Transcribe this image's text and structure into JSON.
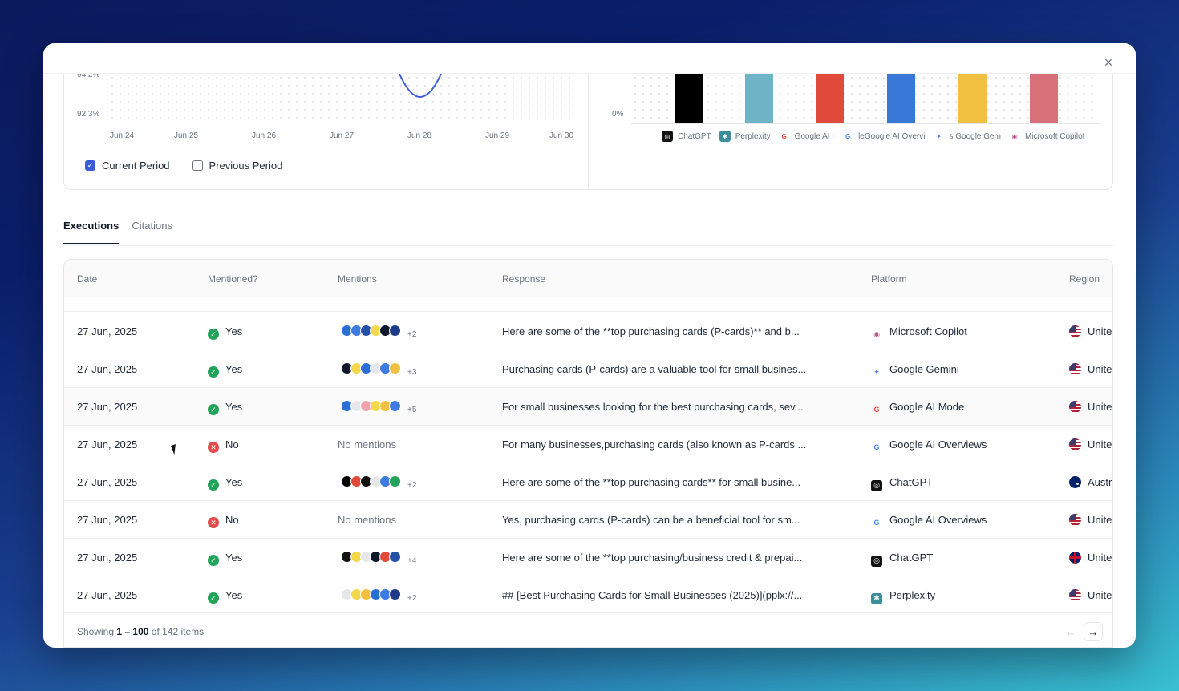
{
  "dialog": {
    "close_icon": "×"
  },
  "line_chart": {
    "y_ticks": [
      "94.2%",
      "92.3%"
    ],
    "x_ticks": [
      "Jun 24",
      "Jun 25",
      "Jun 26",
      "Jun 27",
      "Jun 28",
      "Jun 29",
      "Jun 30"
    ],
    "legend": {
      "current": "Current Period",
      "previous": "Previous Period",
      "current_checked": true,
      "previous_checked": false
    }
  },
  "bar_chart": {
    "y_tick": "0%",
    "bars": [
      {
        "platform": "ChatGPT",
        "color": "#000000"
      },
      {
        "platform": "Perplexity",
        "color": "#6fb3c6"
      },
      {
        "platform": "Google AI Mode",
        "color": "#e04a3a"
      },
      {
        "platform": "Google AI Overviews",
        "color": "#3a78d8"
      },
      {
        "platform": "Google Gemini",
        "color": "#f2c040"
      },
      {
        "platform": "Microsoft Copilot",
        "color": "#d8707a"
      }
    ],
    "legend": [
      {
        "label": "ChatGPT",
        "icon": "chatgpt-icon"
      },
      {
        "label": "Perplexity",
        "icon": "perplexity-icon"
      },
      {
        "label": "Google AI I",
        "icon": "google-icon"
      },
      {
        "label": "leGoogle AI Overvi",
        "icon": "google-icon"
      },
      {
        "label": "s Google Gem",
        "icon": "gemini-icon"
      },
      {
        "label": "Microsoft Copilot",
        "icon": "copilot-icon"
      }
    ]
  },
  "tabs": [
    "Executions",
    "Citations"
  ],
  "table": {
    "headers": [
      "Date",
      "Mentioned?",
      "Mentions",
      "Response",
      "Platform",
      "Region"
    ],
    "rows": [
      {
        "date": "27 Jun, 2025",
        "mentioned": "Yes",
        "mentions_extra": "+2",
        "response": "Here are some of the **top purchasing cards (P-cards)** and b...",
        "platform": "Microsoft Copilot",
        "region": "Unite"
      },
      {
        "date": "27 Jun, 2025",
        "mentioned": "Yes",
        "mentions_extra": "+3",
        "response": "Purchasing cards (P-cards) are a valuable tool for small busines...",
        "platform": "Google Gemini",
        "region": "Unite"
      },
      {
        "date": "27 Jun, 2025",
        "mentioned": "Yes",
        "mentions_extra": "+5",
        "response": "For small businesses looking for the best purchasing cards, sev...",
        "platform": "Google AI Mode",
        "region": "Unite"
      },
      {
        "date": "27 Jun, 2025",
        "mentioned": "No",
        "mentions_text": "No mentions",
        "response": "For many businesses,purchasing cards (also known as P-cards ...",
        "platform": "Google AI Overviews",
        "region": "Unite"
      },
      {
        "date": "27 Jun, 2025",
        "mentioned": "Yes",
        "mentions_extra": "+2",
        "response": "Here are some of the **top purchasing cards** for small busine...",
        "platform": "ChatGPT",
        "region": "Austr"
      },
      {
        "date": "27 Jun, 2025",
        "mentioned": "No",
        "mentions_text": "No mentions",
        "response": "Yes, purchasing cards (P-cards) can be a beneficial tool for sm...",
        "platform": "Google AI Overviews",
        "region": "Unite"
      },
      {
        "date": "27 Jun, 2025",
        "mentioned": "Yes",
        "mentions_extra": "+4",
        "response": "Here are some of the **top purchasing/business credit & prepai...",
        "platform": "ChatGPT",
        "region": "Unite"
      },
      {
        "date": "27 Jun, 2025",
        "mentioned": "Yes",
        "mentions_extra": "+2",
        "response": "## [Best Purchasing Cards for Small Businesses (2025)](pplx://...",
        "platform": "Perplexity",
        "region": "Unite"
      }
    ]
  },
  "footer": {
    "prefix": "Showing",
    "range": "1 – 100",
    "suffix": "of 142 items",
    "prev": "←",
    "next": "→"
  }
}
